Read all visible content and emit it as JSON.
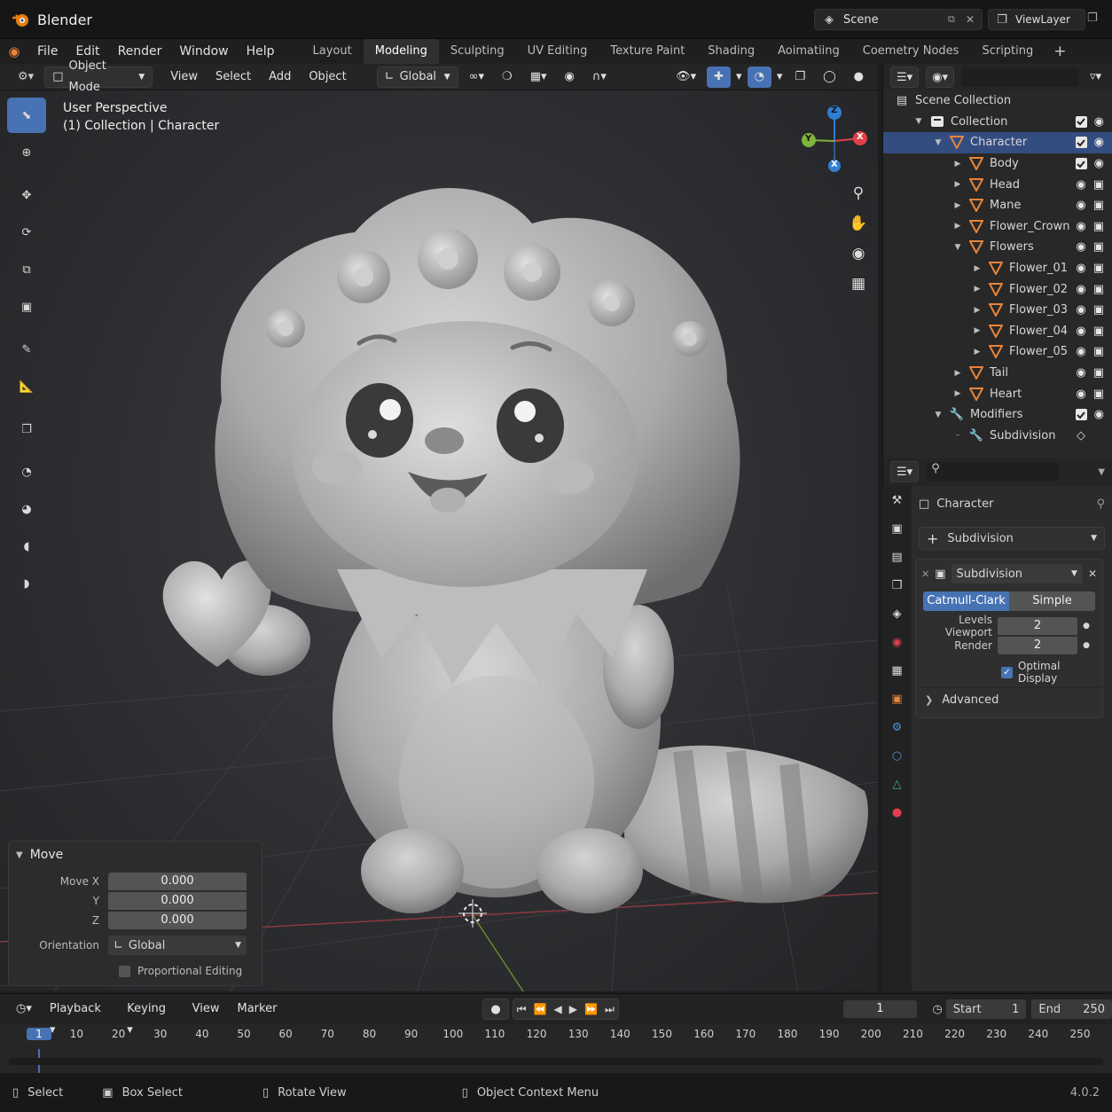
{
  "app": {
    "title": "Blender",
    "version": "4.0.2"
  },
  "topbar": {
    "scene": "Scene",
    "view_layer": "ViewLayer"
  },
  "menu": [
    "File",
    "Edit",
    "Render",
    "Window",
    "Help"
  ],
  "workspaces": [
    {
      "label": "Layout",
      "active": false
    },
    {
      "label": "Modeling",
      "active": true
    },
    {
      "label": "Sculpting",
      "active": false
    },
    {
      "label": "UV Editing",
      "active": false
    },
    {
      "label": "Texture Paint",
      "active": false
    },
    {
      "label": "Shading",
      "active": false
    },
    {
      "label": "Aoimatiing",
      "active": false
    },
    {
      "label": "Coemetry Nodes",
      "active": false
    },
    {
      "label": "Scripting",
      "active": false
    }
  ],
  "header3d": {
    "mode": "Object Mode",
    "menus": [
      "View",
      "Select",
      "Add",
      "Object"
    ],
    "orientation": "Global"
  },
  "viewport": {
    "line1": "User Perspective",
    "line2": "(1) Collection | Character",
    "gizmo": {
      "z": "Z",
      "y": "Y",
      "x": "X"
    }
  },
  "outliner": {
    "scene_collection": "Scene Collection",
    "rows": [
      {
        "label": "Collection",
        "depth": 1,
        "expanded": true,
        "kind": "collection"
      },
      {
        "label": "Character",
        "depth": 2,
        "expanded": true,
        "kind": "mesh",
        "selected": true
      },
      {
        "label": "Body",
        "depth": 3,
        "expanded": false,
        "kind": "mesh"
      },
      {
        "label": "Head",
        "depth": 3,
        "expanded": false,
        "kind": "mesh"
      },
      {
        "label": "Mane",
        "depth": 3,
        "expanded": false,
        "kind": "mesh"
      },
      {
        "label": "Flower_Crown",
        "depth": 3,
        "expanded": false,
        "kind": "mesh"
      },
      {
        "label": "Flowers",
        "depth": 3,
        "expanded": true,
        "kind": "mesh"
      },
      {
        "label": "Flower_01",
        "depth": 4,
        "expanded": false,
        "kind": "mesh"
      },
      {
        "label": "Flower_02",
        "depth": 4,
        "expanded": false,
        "kind": "mesh"
      },
      {
        "label": "Flower_03",
        "depth": 4,
        "expanded": false,
        "kind": "mesh"
      },
      {
        "label": "Flower_04",
        "depth": 4,
        "expanded": false,
        "kind": "mesh"
      },
      {
        "label": "Flower_05",
        "depth": 4,
        "expanded": false,
        "kind": "mesh"
      },
      {
        "label": "Tail",
        "depth": 3,
        "expanded": false,
        "kind": "mesh"
      },
      {
        "label": "Heart",
        "depth": 3,
        "expanded": false,
        "kind": "mesh"
      },
      {
        "label": "Modifiers",
        "depth": 2,
        "expanded": true,
        "kind": "modifiers"
      },
      {
        "label": "Subdivision",
        "depth": 3,
        "expanded": false,
        "kind": "wrench"
      }
    ]
  },
  "properties": {
    "object": "Character",
    "add_modifier": "Subdivision",
    "modifier_name": "Subdivision",
    "algo_a": "Catmull-Clark",
    "algo_b": "Simple",
    "levels_viewport_label": "Levels Viewport",
    "levels_viewport": "2",
    "render_label": "Render",
    "render": "2",
    "optimal_display": "Optimal Display",
    "advanced": "Advanced"
  },
  "move_panel": {
    "title": "Move",
    "move_x_label": "Move X",
    "move_x": "0.000",
    "y_label": "Y",
    "y": "0.000",
    "z_label": "Z",
    "z": "0.000",
    "orientation_label": "Orientation",
    "orientation": "Global",
    "proportional": "Proportional Editing"
  },
  "timeline": {
    "menus": [
      "Playback",
      "Keying",
      "View",
      "Marker"
    ],
    "current_frame": "1",
    "start_label": "Start",
    "start": "1",
    "end_label": "End",
    "end": "250",
    "ticks": [
      "1",
      "10",
      "20",
      "30",
      "40",
      "50",
      "60",
      "70",
      "80",
      "90",
      "100",
      "110",
      "120",
      "130",
      "140",
      "150",
      "160",
      "170",
      "180",
      "190",
      "200",
      "210",
      "220",
      "230",
      "240",
      "250"
    ]
  },
  "status": {
    "select": "Select",
    "box_select": "Box Select",
    "rotate": "Rotate View",
    "context": "Object Context Menu"
  },
  "colors": {
    "accent": "#4772b3",
    "selected_row": "#334d80",
    "mesh_icon": "#e8843a",
    "axis_x": "#e0404c",
    "axis_y": "#7fb33a",
    "axis_z": "#2f7fd4"
  }
}
